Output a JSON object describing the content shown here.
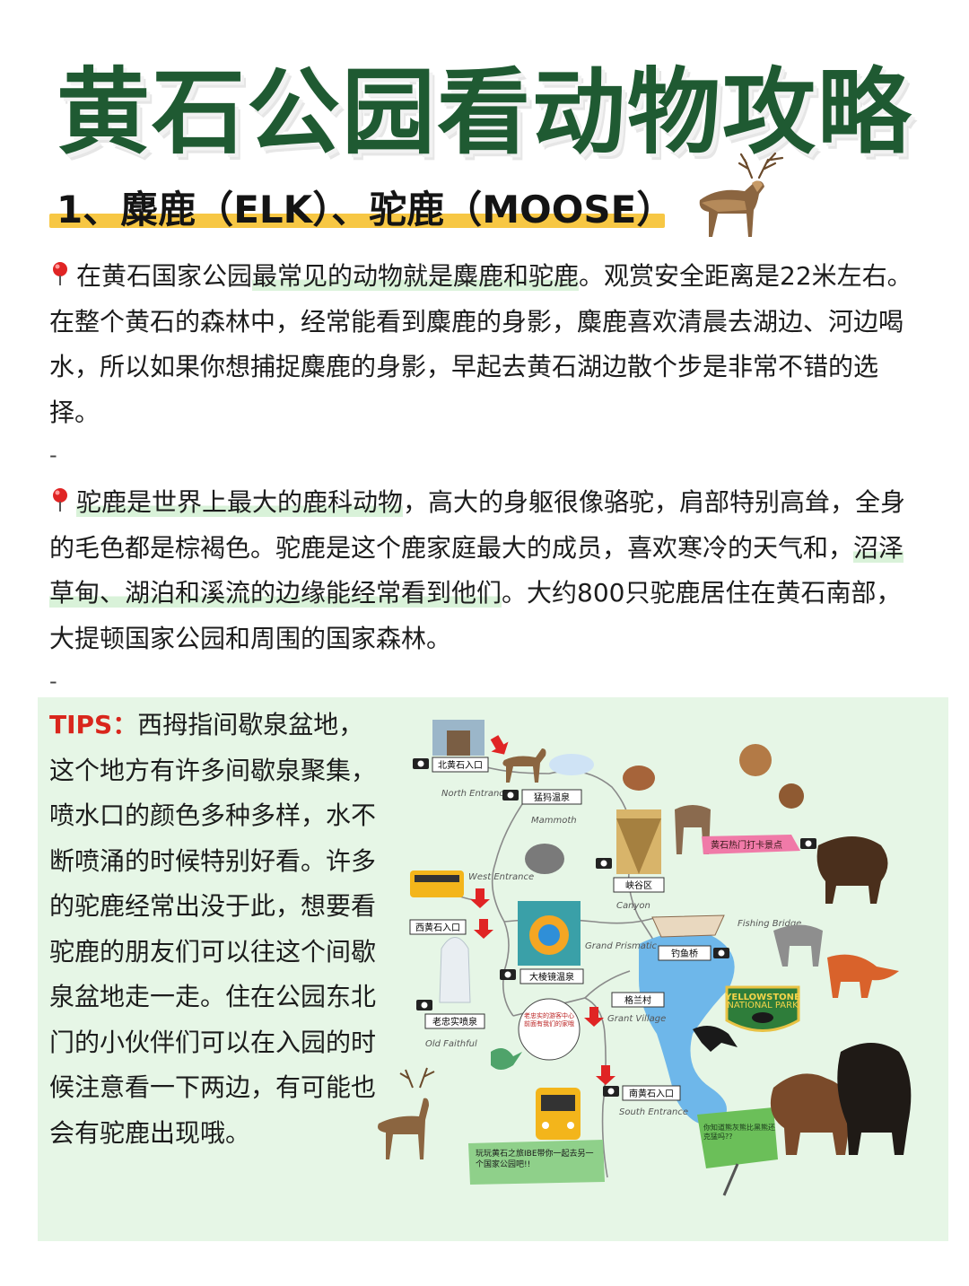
{
  "title": "黄石公园看动物攻略",
  "section1": {
    "heading": "1、麋鹿（ELK）、驼鹿（MOOSE）"
  },
  "para1": {
    "pre": "在黄石国家公园",
    "highlight": "最常见的动物就是麋鹿和驼鹿",
    "post": "。观赏安全距离是22米左右。在整个黄石的森林中，经常能看到麋鹿的身影，麋鹿喜欢清晨去湖边、河边喝水，所以如果你想捕捉麋鹿的身影，早起去黄石湖边散个步是非常不错的选择。"
  },
  "separator": "-",
  "para2": {
    "highlight1": "驼鹿是世界上最大的鹿科动物",
    "mid": "，高大的身躯很像骆驼，肩部特别高耸，全身的毛色都是棕褐色。驼鹿是这个鹿家庭最大的成员，喜欢寒冷的天气和，",
    "highlight2": "沼泽草甸、湖泊和溪流的边缘能经常看到他们",
    "post": "。大约800只驼鹿居住在黄石南部，大提顿国家公园和周围的国家森林。"
  },
  "tips": {
    "label": "TIPS：",
    "text": "西拇指间歇泉盆地，这个地方有许多间歇泉聚集，喷水口的颜色多种多样，水不断喷涌的时候特别好看。许多的驼鹿经常出没于此，想要看驼鹿的朋友们可以往这个间歇泉盆地走一走。住在公园东北门的小伙伴们可以在入园的时候注意看一下两边，有可能也会有驼鹿出现哦。"
  },
  "map": {
    "north_entrance_cn": "北黄石入口",
    "north_entrance_en": "North Entrance",
    "mammoth_cn": "猛犸温泉",
    "mammoth_en": "Mammoth",
    "checkin_sign": "黄石热门打卡景点",
    "canyon_cn": "峡谷区",
    "canyon_en": "Canyon",
    "west_entrance_cn": "西黄石入口",
    "west_entrance_en": "West Entrance",
    "fishing_bridge_en": "Fishing Bridge",
    "fishing_bridge_cn": "钓鱼桥",
    "grand_prismatic_cn": "大棱镜温泉",
    "grand_prismatic_en": "Grand Prismatic",
    "grant_village_cn": "格兰村",
    "grant_village_en": "Grant Village",
    "old_faithful_cn": "老忠实喷泉",
    "old_faithful_en": "Old Faithful",
    "bubble_note": "老忠实的游客中心前面有我们的家哦",
    "south_entrance_cn": "南黄石入口",
    "south_entrance_en": "South Entrance",
    "bottom_note": "玩玩黄石之旅IBE带你一起去另一个国家公园吧!!",
    "flag_note": "你知道熊灰熊比黑熊还克猛吗??",
    "badge_main": "YELLOWSTONE",
    "badge_sub": "NATIONAL PARK"
  },
  "colors": {
    "title": "#1f5a32",
    "heading_bar": "#f7c744",
    "tips_bg": "#e6f6e6",
    "tips_label": "#d9261c",
    "highlight": "#d9f2d9"
  }
}
